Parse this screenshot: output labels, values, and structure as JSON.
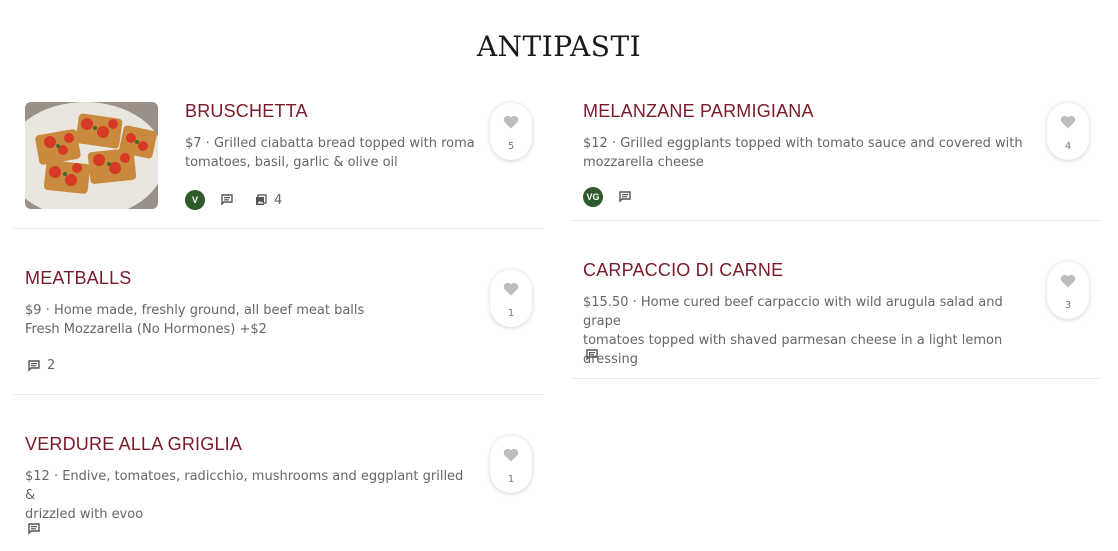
{
  "section": {
    "title": "ANTIPASTI"
  },
  "items": [
    {
      "name": "BRUSCHETTA",
      "desc_line1": "$7 · Grilled ciabatta bread topped with roma",
      "desc_line2": "tomatoes, basil, garlic & olive oil",
      "diet_badge": "V",
      "photo_count": "4",
      "likes": "5"
    },
    {
      "name": "MELANZANE PARMIGIANA",
      "desc_line1": "$12 · Grilled eggplants topped with tomato sauce and covered with",
      "desc_line2": "mozzarella cheese",
      "diet_badge": "VG",
      "likes": "4"
    },
    {
      "name": "MEATBALLS",
      "desc_line1": "$9 · Home made, freshly ground, all beef meat balls",
      "desc_line2": "Fresh Mozzarella (No Hormones) +$2",
      "comment_count": "2",
      "likes": "1"
    },
    {
      "name": "CARPACCIO DI CARNE",
      "desc_line1": "$15.50 · Home cured beef carpaccio with wild arugula salad and grape",
      "desc_line2": "tomatoes topped with shaved parmesan cheese in a light lemon dressing",
      "likes": "3"
    },
    {
      "name": "VERDURE ALLA GRIGLIA",
      "desc_line1": "$12 · Endive, tomatoes, radicchio, mushrooms and eggplant grilled &",
      "desc_line2": "drizzled with evoo",
      "likes": "1"
    }
  ],
  "icons": {
    "heart": "heart-icon",
    "comment": "comment-icon",
    "photo": "photos-icon"
  },
  "colors": {
    "item_name": "#7a1a2b",
    "diet_badge": "#2f5a2a",
    "heart": "#bdbdbd"
  }
}
